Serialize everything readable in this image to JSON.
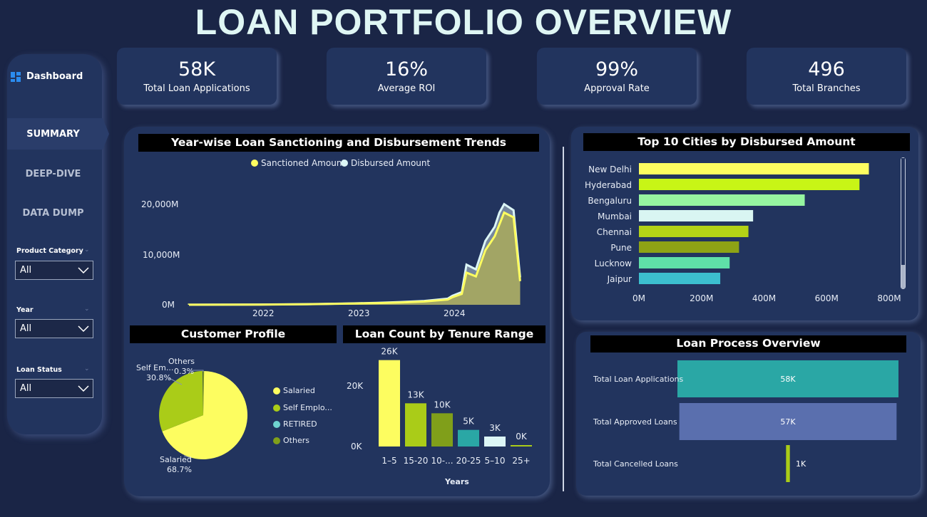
{
  "title": "LOAN PORTFOLIO OVERVIEW",
  "nav": {
    "dashboard": "Dashboard",
    "items": [
      "SUMMARY",
      "DEEP-DIVE",
      "DATA DUMP"
    ],
    "active": "SUMMARY"
  },
  "filters": [
    {
      "label": "Product Category",
      "value": "All"
    },
    {
      "label": "Year",
      "value": "All"
    },
    {
      "label": "Loan Status",
      "value": "All"
    }
  ],
  "kpis": [
    {
      "value": "58K",
      "label": "Total Loan Applications"
    },
    {
      "value": "16%",
      "label": "Average ROI"
    },
    {
      "value": "99%",
      "label": "Approval Rate"
    },
    {
      "value": "496",
      "label": "Total Branches"
    }
  ],
  "colors": {
    "bg": "#1a2546",
    "panel": "#22345e",
    "sanctioned": "#fdfd60",
    "disbursed": "#dcf6f6"
  },
  "chart_data": [
    {
      "type": "area",
      "title": "Year-wise Loan Sanctioning and Disbursement Trends",
      "legend": [
        {
          "name": "Sanctioned Amount",
          "color": "#fdfd60"
        },
        {
          "name": "Disbursed Amount",
          "color": "#dcf6f6"
        }
      ],
      "yticks": [
        "20,000M",
        "10,000M",
        "0M"
      ],
      "xticks": [
        "2022",
        "2023",
        "2024"
      ],
      "ylim": [
        0,
        25000
      ],
      "x": [
        2021.25,
        2021.5,
        2021.75,
        2022,
        2022.25,
        2022.5,
        2022.75,
        2023,
        2023.25,
        2023.5,
        2023.75,
        2024,
        2024.05,
        2024.15,
        2024.2,
        2024.3,
        2024.4,
        2024.5,
        2024.55,
        2024.6,
        2024.7,
        2024.77
      ],
      "series": [
        {
          "name": "Sanctioned Amount",
          "values": [
            10,
            20,
            30,
            50,
            80,
            120,
            180,
            260,
            360,
            500,
            700,
            1100,
            1600,
            2300,
            6800,
            6000,
            11500,
            14500,
            17000,
            19500,
            18500,
            5000
          ]
        },
        {
          "name": "Disbursed Amount",
          "values": [
            12,
            25,
            35,
            60,
            95,
            140,
            210,
            300,
            420,
            580,
            820,
            1300,
            1900,
            2700,
            8500,
            7500,
            13500,
            16500,
            19500,
            21300,
            20000,
            5800
          ]
        }
      ]
    },
    {
      "type": "bar",
      "orientation": "horizontal",
      "title": "Top 10 Cities by Disbursed Amount",
      "categories": [
        "New Delhi",
        "Hyderabad",
        "Bengaluru",
        "Mumbai",
        "Chennai",
        "Pune",
        "Lucknow",
        "Jaipur"
      ],
      "values": [
        735,
        705,
        530,
        365,
        350,
        320,
        290,
        260
      ],
      "colors": [
        "#fdfd60",
        "#c8f516",
        "#96f5a0",
        "#d9f5f2",
        "#b3d316",
        "#8ea315",
        "#5fe0a8",
        "#3cbfcf"
      ],
      "xticks": [
        "0M",
        "200M",
        "400M",
        "600M",
        "800M"
      ],
      "xlim": [
        0,
        800
      ]
    },
    {
      "type": "pie",
      "title": "Customer Profile",
      "slices": [
        {
          "name": "Salaried",
          "value": 68.7,
          "label": "Salaried",
          "pct": "68.7%",
          "color": "#fdfd60"
        },
        {
          "name": "Self Employed",
          "value": 30.8,
          "label": "Self Em...",
          "pct": "30.8%",
          "color": "#aacc18"
        },
        {
          "name": "Others",
          "value": 0.3,
          "label": "Others",
          "pct": "0.3%",
          "color": "#809f1a"
        }
      ],
      "legend": [
        {
          "name": "Salaried",
          "color": "#fdfd60"
        },
        {
          "name": "Self Emplo...",
          "color": "#aacc18"
        },
        {
          "name": "RETIRED",
          "color": "#6fd3d0"
        },
        {
          "name": "Others",
          "color": "#809f1a"
        }
      ]
    },
    {
      "type": "bar",
      "title": "Loan Count by Tenure Range",
      "categories": [
        "1–5",
        "15-20",
        "10-...",
        "20-25",
        "5–10",
        "25+"
      ],
      "values": [
        26,
        13,
        10,
        5,
        3,
        0.3
      ],
      "labels": [
        "26K",
        "13K",
        "10K",
        "5K",
        "3K",
        "0K"
      ],
      "colors": [
        "#fdfd60",
        "#aacc18",
        "#809f1a",
        "#2aa7a5",
        "#dcf6f6",
        "#aacc18"
      ],
      "yticks": [
        "20K",
        "0K"
      ],
      "xlabel": "Years",
      "ylim": [
        0,
        30
      ]
    },
    {
      "type": "bar",
      "orientation": "funnel",
      "title": "Loan Process Overview",
      "categories": [
        "Total Loan Applications",
        "Total Approved Loans",
        "Total Cancelled Loans"
      ],
      "values": [
        58,
        57,
        1
      ],
      "labels": [
        "58K",
        "57K",
        "1K"
      ],
      "colors": [
        "#2aa7a5",
        "#5a6fae",
        "#aacc18"
      ]
    }
  ]
}
